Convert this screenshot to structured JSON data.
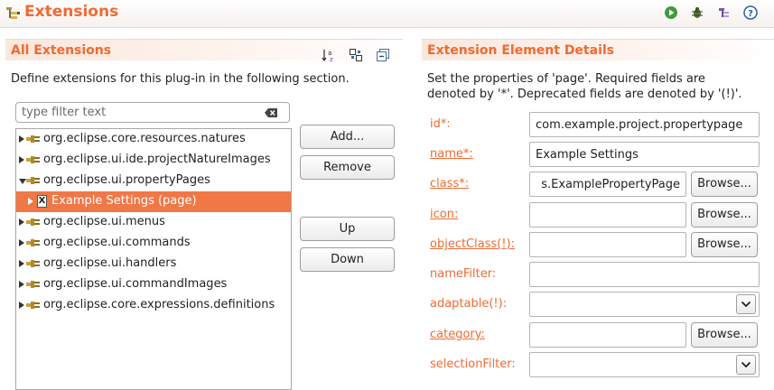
{
  "header": {
    "title": "Extensions",
    "icons": [
      "extensions-icon",
      "run-icon",
      "debug-icon",
      "extension-point-icon",
      "help-icon"
    ]
  },
  "left": {
    "title": "All Extensions",
    "description": "Define extensions for this plug-in in the following section.",
    "tools": [
      "sort-icon",
      "show-ext-point-icon",
      "collapse-all-icon"
    ],
    "filter_placeholder": "type filter text",
    "tree": [
      {
        "label": "org.eclipse.core.resources.natures",
        "state": "collapsed",
        "depth": 0
      },
      {
        "label": "org.eclipse.ui.ide.projectNatureImages",
        "state": "collapsed",
        "depth": 0
      },
      {
        "label": "org.eclipse.ui.propertyPages",
        "state": "expanded",
        "depth": 0
      },
      {
        "label": "Example Settings (page)",
        "state": "collapsed",
        "depth": 1,
        "selected": true,
        "icon_letter": "X"
      },
      {
        "label": "org.eclipse.ui.menus",
        "state": "collapsed",
        "depth": 0
      },
      {
        "label": "org.eclipse.ui.commands",
        "state": "collapsed",
        "depth": 0
      },
      {
        "label": "org.eclipse.ui.handlers",
        "state": "collapsed",
        "depth": 0
      },
      {
        "label": "org.eclipse.ui.commandImages",
        "state": "collapsed",
        "depth": 0
      },
      {
        "label": "org.eclipse.core.expressions.definitions",
        "state": "collapsed",
        "depth": 0
      }
    ],
    "buttons": {
      "add": "Add...",
      "remove": "Remove",
      "up": "Up",
      "down": "Down"
    }
  },
  "right": {
    "title": "Extension Element Details",
    "description_line1": "Set the properties of 'page'. Required fields are",
    "description_line2": "denoted by '*'. Deprecated fields are denoted by '(!)'.",
    "browse_label": "Browse...",
    "fields": {
      "id": {
        "label": "id*:",
        "value": "com.example.project.propertypage"
      },
      "name": {
        "label": "name*:",
        "value": "Example Settings"
      },
      "class": {
        "label": "class*:",
        "value": "s.ExamplePropertyPage"
      },
      "icon": {
        "label": "icon:",
        "value": ""
      },
      "objectClass": {
        "label": "objectClass(!):",
        "value": ""
      },
      "nameFilter": {
        "label": "nameFilter:",
        "value": ""
      },
      "adaptable": {
        "label": "adaptable(!):",
        "value": ""
      },
      "category": {
        "label": "category:",
        "value": ""
      },
      "selectionFilter": {
        "label": "selectionFilter:",
        "value": ""
      }
    }
  },
  "colors": {
    "accent": "#ef6a33",
    "selection": "#f07847"
  }
}
